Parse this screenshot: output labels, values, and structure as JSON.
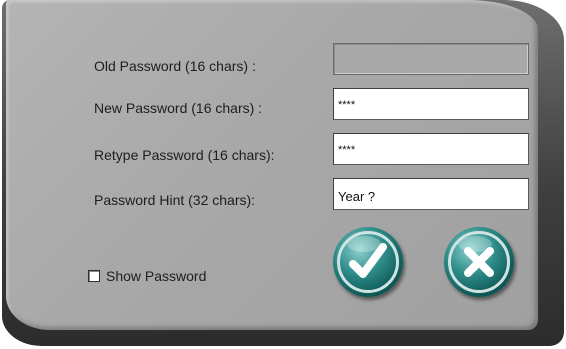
{
  "dialog": {
    "fields": [
      {
        "label": "Old Password (16 chars) :",
        "value": "",
        "state": "disabled"
      },
      {
        "label": "New Password (16 chars) :",
        "value": "****",
        "state": "masked"
      },
      {
        "label": "Retype Password (16 chars):",
        "value": "****",
        "state": "masked"
      },
      {
        "label": "Password Hint (32 chars):",
        "value": "Year ?",
        "state": "text"
      }
    ],
    "show_password": {
      "label": "Show Password",
      "checked": false
    },
    "buttons": {
      "ok": {
        "icon": "checkmark-icon",
        "color": "#1f7a78"
      },
      "cancel": {
        "icon": "x-icon",
        "color": "#1f7a78"
      }
    }
  }
}
